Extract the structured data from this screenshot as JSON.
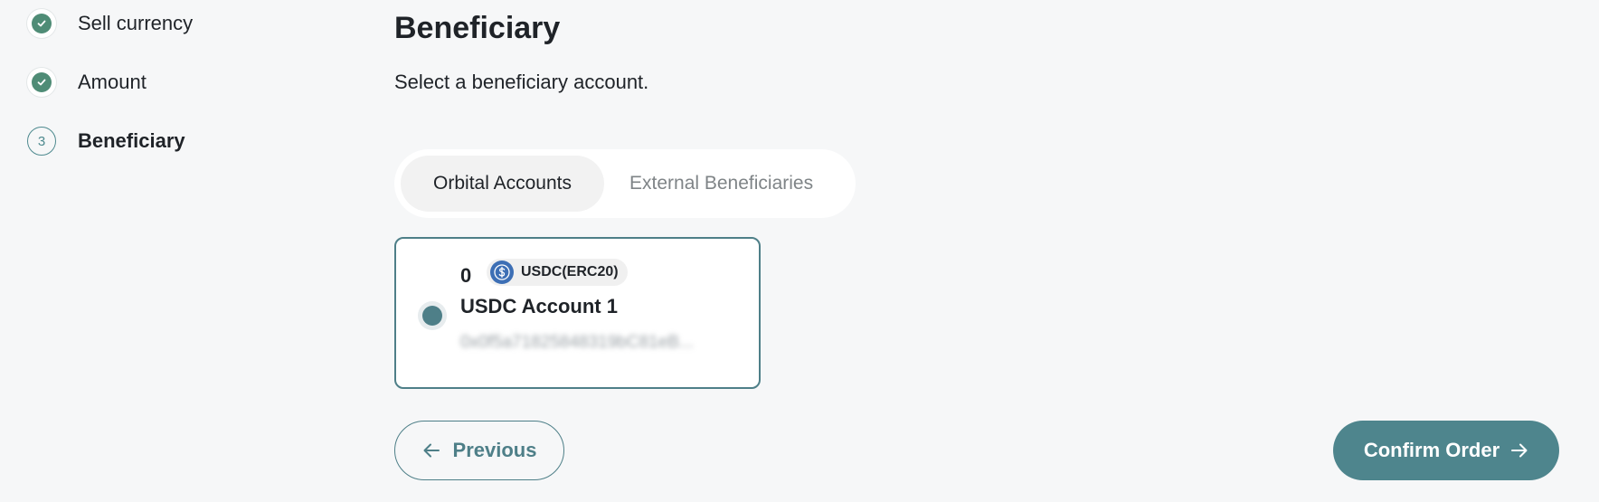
{
  "stepper": {
    "steps": [
      {
        "label": "Sell currency",
        "status": "done"
      },
      {
        "label": "Amount",
        "status": "done"
      },
      {
        "label": "Beneficiary",
        "status": "current",
        "number": "3"
      }
    ]
  },
  "main": {
    "title": "Beneficiary",
    "subtitle": "Select a beneficiary account.",
    "tabs": [
      {
        "label": "Orbital Accounts",
        "active": true
      },
      {
        "label": "External Beneficiaries",
        "active": false
      }
    ],
    "account": {
      "balance": "0",
      "currency_label": "USDC(ERC20)",
      "currency_icon": "usdc-coin-icon",
      "name": "USDC Account 1",
      "address": "0x0f5a71825848319bC81eB...",
      "selected": true
    }
  },
  "actions": {
    "previous_label": "Previous",
    "confirm_label": "Confirm Order"
  },
  "colors": {
    "accent": "#4e858d",
    "check_green": "#4f8c76",
    "usdc_blue": "#3d6fb5",
    "background": "#f6f7f8"
  }
}
